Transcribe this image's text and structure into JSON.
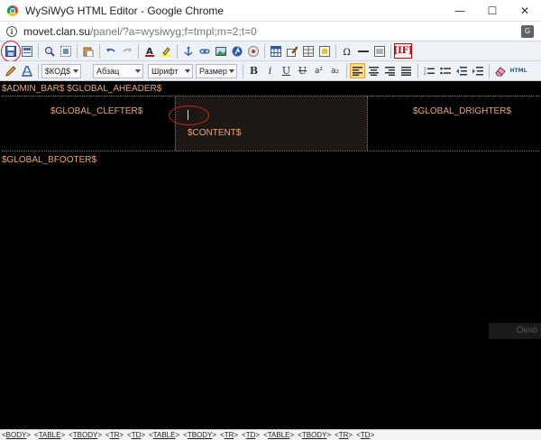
{
  "window": {
    "title": "WySiWyG HTML Editor - Google Chrome",
    "minimize": "—",
    "maximize": "☐",
    "close": "✕"
  },
  "address": {
    "domain": "movet.clan.su",
    "path": "/panel/?a=wysiwyg;f=tmpl;m=2;t=0"
  },
  "toolbar2": {
    "code_select": "$КОД$",
    "paragraph_select": "Абзац",
    "font_select": "Шрифт",
    "size_select": "Размер",
    "bold": "B",
    "italic": "i",
    "underline": "U",
    "strike": "U",
    "sup": "a²",
    "sub": "a₂",
    "html_label": "HTML"
  },
  "toolbar1": {
    "if_label": "[IF]"
  },
  "editor": {
    "top_line": "$ADMIN_BAR$ $GLOBAL_AHEADER$",
    "left_cell": "$GLOBAL_CLEFTER$",
    "center_cell": "$CONTENT$",
    "right_cell": "$GLOBAL_DRIGHTER$",
    "footer": "$GLOBAL_BFOOTER$",
    "okno": "Окно"
  },
  "statusbar": {
    "tags": [
      "<BODY>",
      "<TABLE>",
      "<TBODY>",
      "<TR>",
      "<TD>",
      "<TABLE>",
      "<TBODY>",
      "<TR>",
      "<TD>",
      "<TABLE>",
      "<TBODY>",
      "<TR>",
      "<TD>"
    ]
  },
  "colors": {
    "editor_background": "#000000",
    "template_variable": "#e8a870",
    "annotation_circle": "#d62020",
    "active_button": "#fbd98b"
  }
}
